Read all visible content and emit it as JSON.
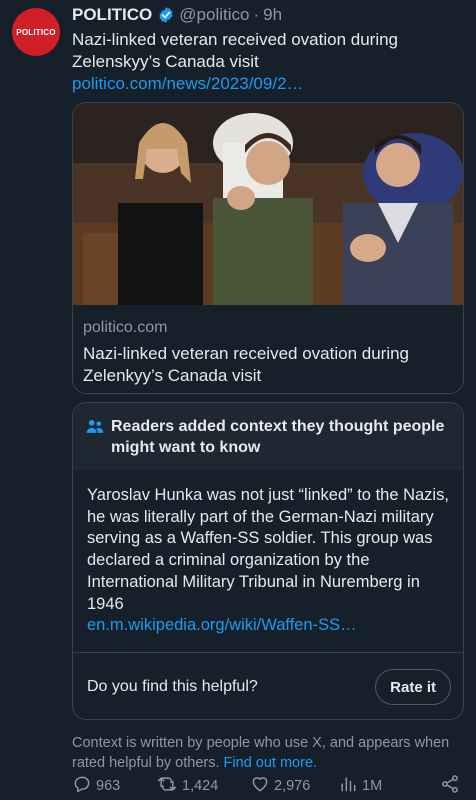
{
  "tweet": {
    "avatar_text": "POLITICO",
    "author_name": "POLITICO",
    "handle": "@politico",
    "separator": "·",
    "time": "9h",
    "text": "Nazi-linked veteran received ovation during Zelenskyy’s Canada visit",
    "link": "politico.com/news/2023/09/2…"
  },
  "card": {
    "domain": "politico.com",
    "title": "Nazi-linked veteran received ovation during Zelenkyy’s Canada visit"
  },
  "note": {
    "title": "Readers added context they thought people might want to know",
    "body": "Yaroslav Hunka was not just “linked” to the Nazis, he was literally part of the German-Nazi military serving as a Waffen-SS soldier. This group was declared a criminal organization by the International Military Tribunal in Nuremberg in 1946",
    "link": "en.m.wikipedia.org/wiki/Waffen-SS…",
    "helpful_question": "Do you find this helpful?",
    "rate_label": "Rate it"
  },
  "footnote": {
    "text": "Context is written by people who use X, and appears when rated helpful by others.",
    "link": "Find out more."
  },
  "actions": {
    "replies": "963",
    "reposts": "1,424",
    "likes": "2,976",
    "views": "1M"
  },
  "colors": {
    "background": "#15202b",
    "accent": "#1d9bf0",
    "brand": "#d11f2a",
    "muted": "#8b98a5"
  }
}
